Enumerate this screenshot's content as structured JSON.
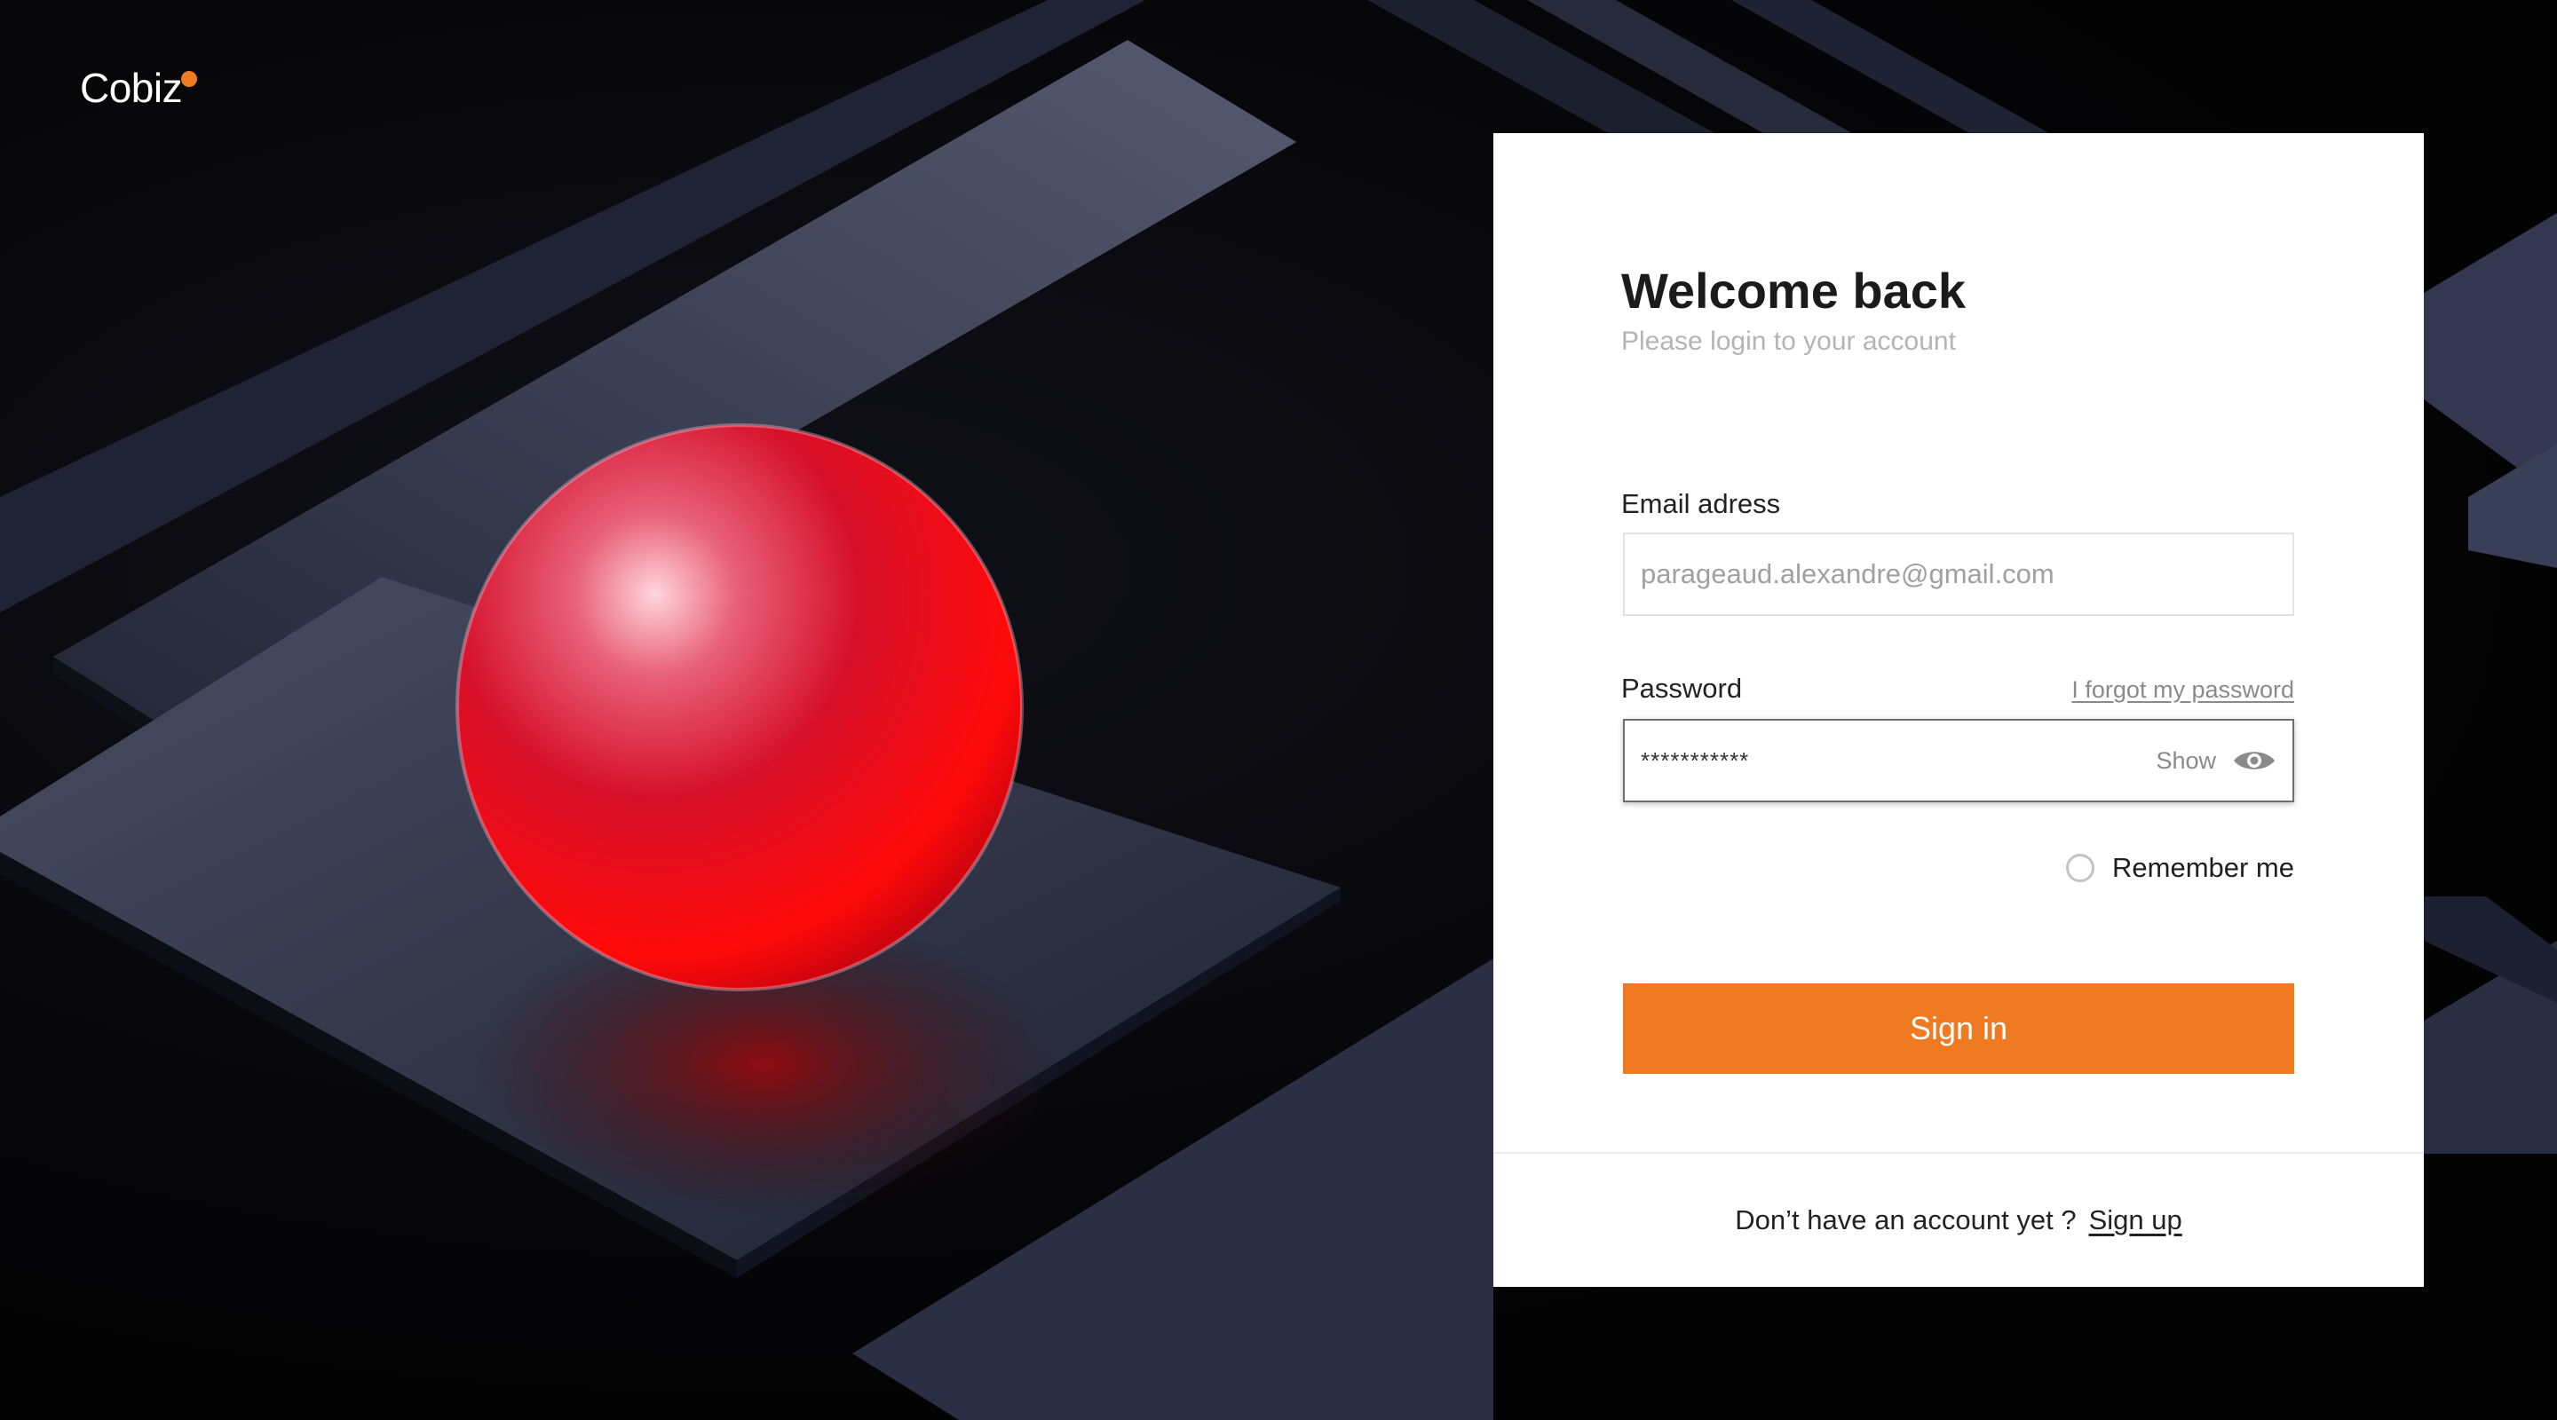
{
  "brand": {
    "name": "Cobiz",
    "accent_color": "#f07a21"
  },
  "login": {
    "title": "Welcome back",
    "subtitle": "Please login to your account",
    "email": {
      "label": "Email adress",
      "value": "parageaud.alexandre@gmail.com"
    },
    "password": {
      "label": "Password",
      "value": "***********",
      "forgot_link": "I forgot my password",
      "show_label": "Show",
      "show_icon": "eye-icon"
    },
    "remember": {
      "label": "Remember me",
      "checked": false
    },
    "submit_label": "Sign in",
    "footer": {
      "prompt": "Don’t have an account yet ?",
      "link": "Sign up"
    }
  },
  "background": {
    "sphere_color": "#ff1a1a",
    "slab_color": "#2a2e40"
  }
}
